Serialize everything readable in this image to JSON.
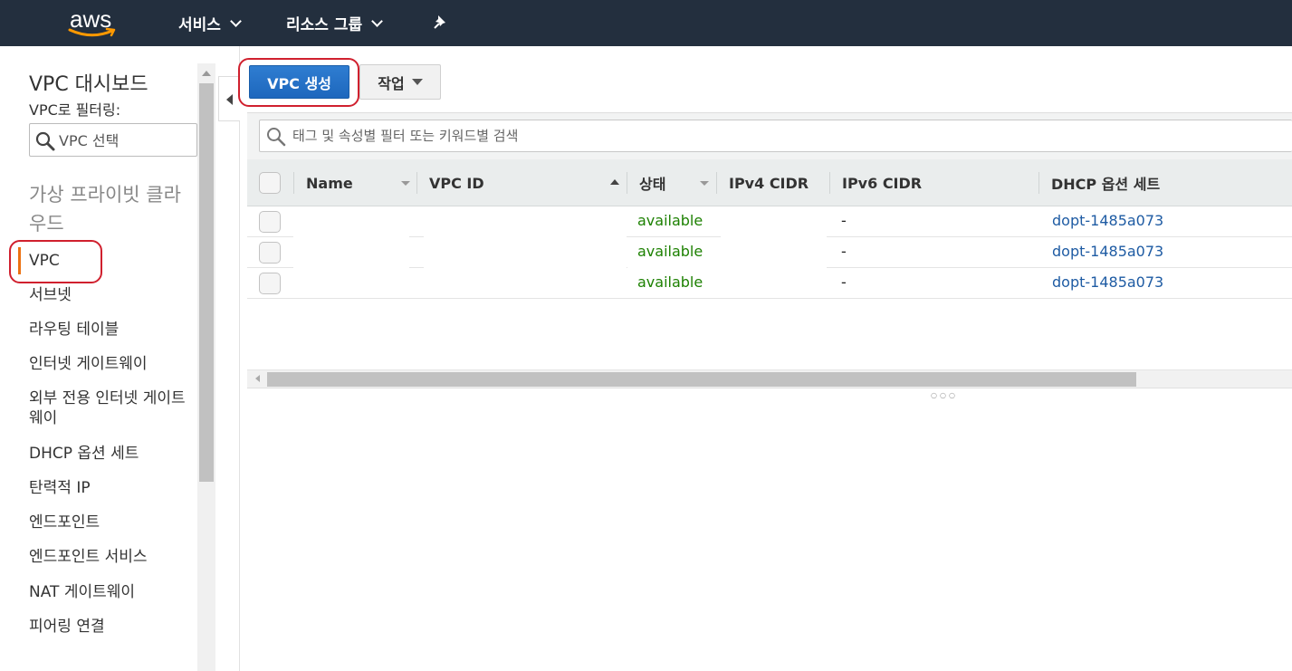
{
  "topnav": {
    "logo": "aws",
    "services_label": "서비스",
    "resource_groups_label": "리소스 그룹",
    "pin_icon": "pushpin-icon",
    "background": "#232f3e"
  },
  "sidebar": {
    "title": "VPC 대시보드",
    "filter_label": "VPC로 필터링:",
    "filter_placeholder": "VPC 선택",
    "section_title": "가상 프라이빗 클라우드",
    "items": [
      {
        "label": "VPC",
        "active": true
      },
      {
        "label": "서브넷"
      },
      {
        "label": "라우팅 테이블"
      },
      {
        "label": "인터넷 게이트웨이"
      },
      {
        "label": "외부 전용 인터넷 게이트웨이"
      },
      {
        "label": "DHCP 옵션 세트"
      },
      {
        "label": "탄력적 IP"
      },
      {
        "label": "엔드포인트"
      },
      {
        "label": "엔드포인트 서비스"
      },
      {
        "label": "NAT 게이트웨이"
      },
      {
        "label": "피어링 연결"
      }
    ],
    "active_color": "#ec7211"
  },
  "toolbar": {
    "create_vpc_label": "VPC 생성",
    "actions_label": "작업"
  },
  "search": {
    "placeholder": "태그 및 속성별 필터 또는 키워드별 검색"
  },
  "table": {
    "columns": [
      "Name",
      "VPC ID",
      "상태",
      "IPv4 CIDR",
      "IPv6 CIDR",
      "DHCP 옵션 세트"
    ],
    "sorted_column": "VPC ID",
    "rows": [
      {
        "name": "",
        "vpc_id": "",
        "status": "available",
        "ipv4_cidr": "",
        "ipv6_cidr": "-",
        "dhcp_options": "dopt-1485a073"
      },
      {
        "name": "",
        "vpc_id": "",
        "status": "available",
        "ipv4_cidr": "",
        "ipv6_cidr": "-",
        "dhcp_options": "dopt-1485a073"
      },
      {
        "name": "",
        "vpc_id": "",
        "status": "available",
        "ipv4_cidr": "",
        "ipv6_cidr": "-",
        "dhcp_options": "dopt-1485a073"
      }
    ]
  },
  "colors": {
    "primary_button": "#1d67bd",
    "status_available": "#1d8102",
    "link": "#1e5ba3",
    "annotation_ring": "#d0202e"
  }
}
